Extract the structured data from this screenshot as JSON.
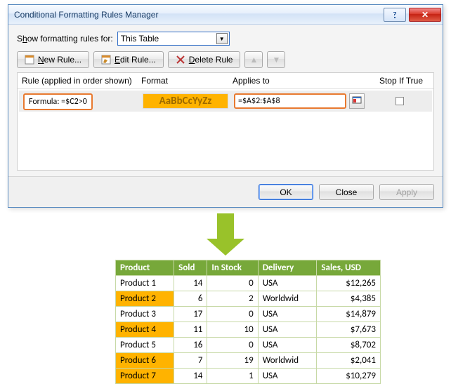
{
  "dialog": {
    "title": "Conditional Formatting Rules Manager",
    "show_label_pre": "S",
    "show_label_u": "h",
    "show_label_post": "ow formatting rules for:",
    "scope_value": "This Table",
    "buttons": {
      "new": "New Rule...",
      "edit": "Edit Rule...",
      "delete": "Delete Rule"
    },
    "headers": {
      "rule": "Rule (applied in order shown)",
      "format": "Format",
      "applies": "Applies to",
      "stop": "Stop If True"
    },
    "rule": {
      "name": "Formula: =$C2>0",
      "format_preview": "AaBbCcYyZz",
      "applies_to": "=$A$2:$A$8"
    },
    "footer": {
      "ok": "OK",
      "close": "Close",
      "apply": "Apply"
    }
  },
  "chart_data": {
    "type": "table",
    "columns": [
      "Product",
      "Sold",
      "In Stock",
      "Delivery",
      "Sales,  USD"
    ],
    "rows": [
      {
        "product": "Product 1",
        "sold": 14,
        "in_stock": 0,
        "delivery": "USA",
        "sales": "$12,265",
        "highlight": false
      },
      {
        "product": "Product 2",
        "sold": 6,
        "in_stock": 2,
        "delivery": "Worldwid",
        "sales": "$4,385",
        "highlight": true
      },
      {
        "product": "Product 3",
        "sold": 17,
        "in_stock": 0,
        "delivery": "USA",
        "sales": "$14,879",
        "highlight": false
      },
      {
        "product": "Product 4",
        "sold": 11,
        "in_stock": 10,
        "delivery": "USA",
        "sales": "$7,673",
        "highlight": true
      },
      {
        "product": "Product 5",
        "sold": 16,
        "in_stock": 0,
        "delivery": "USA",
        "sales": "$8,702",
        "highlight": false
      },
      {
        "product": "Product 6",
        "sold": 7,
        "in_stock": 19,
        "delivery": "Worldwid",
        "sales": "$2,041",
        "highlight": true
      },
      {
        "product": "Product 7",
        "sold": 14,
        "in_stock": 1,
        "delivery": "USA",
        "sales": "$10,279",
        "highlight": true
      }
    ]
  }
}
